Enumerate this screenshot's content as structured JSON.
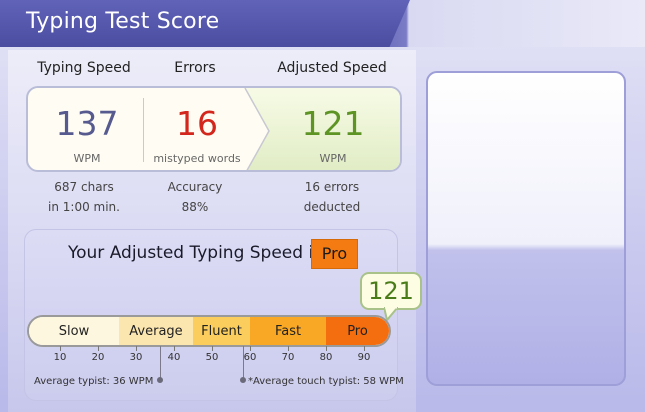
{
  "header": {
    "title": "Typing Test Score"
  },
  "columns": {
    "speed": "Typing Speed",
    "errors": "Errors",
    "adjusted": "Adjusted Speed"
  },
  "score": {
    "wpm": "137",
    "wpm_unit": "WPM",
    "errors": "16",
    "errors_unit": "mistyped words",
    "adjusted": "121",
    "adjusted_unit": "WPM"
  },
  "details": {
    "chars": "687 chars",
    "time": "in 1:00 min.",
    "accuracy_label": "Accuracy",
    "accuracy_value": "88%",
    "errors_deducted": "16 errors",
    "deducted_label": "deducted"
  },
  "level": {
    "prefix": "Your Adjusted Typing Speed is",
    "badge": "Pro",
    "bubble_value": "121",
    "segments": [
      {
        "label": "Slow",
        "color": "#fdf7df"
      },
      {
        "label": "Average",
        "color": "#fce6b0"
      },
      {
        "label": "Fluent",
        "color": "#fbcd5c"
      },
      {
        "label": "Fast",
        "color": "#f9a825"
      },
      {
        "label": "Pro",
        "color": "#f46d0e"
      }
    ],
    "ticks": [
      "10",
      "20",
      "30",
      "40",
      "50",
      "60",
      "70",
      "80",
      "90"
    ],
    "notes": {
      "average": "Average typist: 36 WPM",
      "touch": "*Average touch typist: 58 WPM"
    }
  },
  "colors": {
    "wpm": "#565a8e",
    "errors": "#d3261c",
    "adjusted": "#5d9424",
    "badge": "#f47b12"
  }
}
